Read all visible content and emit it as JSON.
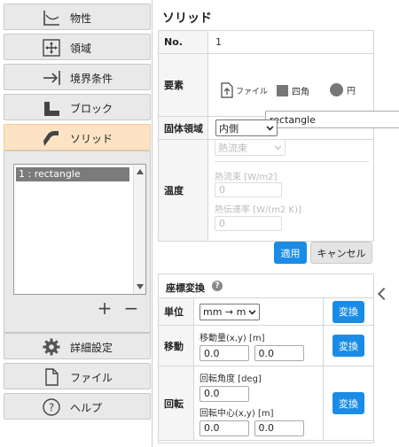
{
  "sidebar": {
    "items": [
      {
        "label": "物性",
        "icon": "graph-axes-icon"
      },
      {
        "label": "領域",
        "icon": "move-arrows-icon"
      },
      {
        "label": "境界条件",
        "icon": "arrow-to-line-icon"
      },
      {
        "label": "ブロック",
        "icon": "block-icon"
      },
      {
        "label": "ソリッド",
        "icon": "solid-pipe-icon"
      },
      {
        "label": "詳細設定",
        "icon": "gear-icon"
      },
      {
        "label": "ファイル",
        "icon": "file-icon"
      },
      {
        "label": "ヘルプ",
        "icon": "help-circle-icon"
      }
    ],
    "list": {
      "items": [
        "1 : rectangle"
      ],
      "add_label": "+",
      "remove_label": "−"
    }
  },
  "main": {
    "title": "ソリッド",
    "no": {
      "label": "No.",
      "value": "1"
    },
    "element": {
      "label": "要素",
      "name_value": "rectangle",
      "shapes": {
        "file": "ファイル",
        "rect": "四角",
        "circle": "円"
      }
    },
    "solid_region": {
      "label": "固体領域",
      "selected": "内側"
    },
    "temperature": {
      "label": "温度",
      "mode_selected": "熱流束",
      "heat_flux_label": "熱流束 [W/m2]",
      "heat_flux_value": "0",
      "heat_transfer_label": "熱伝達率 [W/(m2 K)]",
      "heat_transfer_value": "0"
    },
    "apply_label": "適用",
    "cancel_label": "キャンセル",
    "coord": {
      "title": "座標変換",
      "help": "?",
      "unit": {
        "label": "単位",
        "selected": "mm → m",
        "button": "変換"
      },
      "move": {
        "label": "移動",
        "caption": "移動量(x,y) [m]",
        "x": "0.0",
        "y": "0.0",
        "button": "変換"
      },
      "rotate": {
        "label": "回転",
        "angle_caption": "回転角度 [deg]",
        "angle": "0.0",
        "center_caption": "回転中心(x,y) [m]",
        "cx": "0.0",
        "cy": "0.0",
        "button": "変換"
      }
    }
  },
  "colors": {
    "accent": "#1a8ce6",
    "active_nav": "#fde3c4",
    "list_selected": "#7b7b7b"
  }
}
